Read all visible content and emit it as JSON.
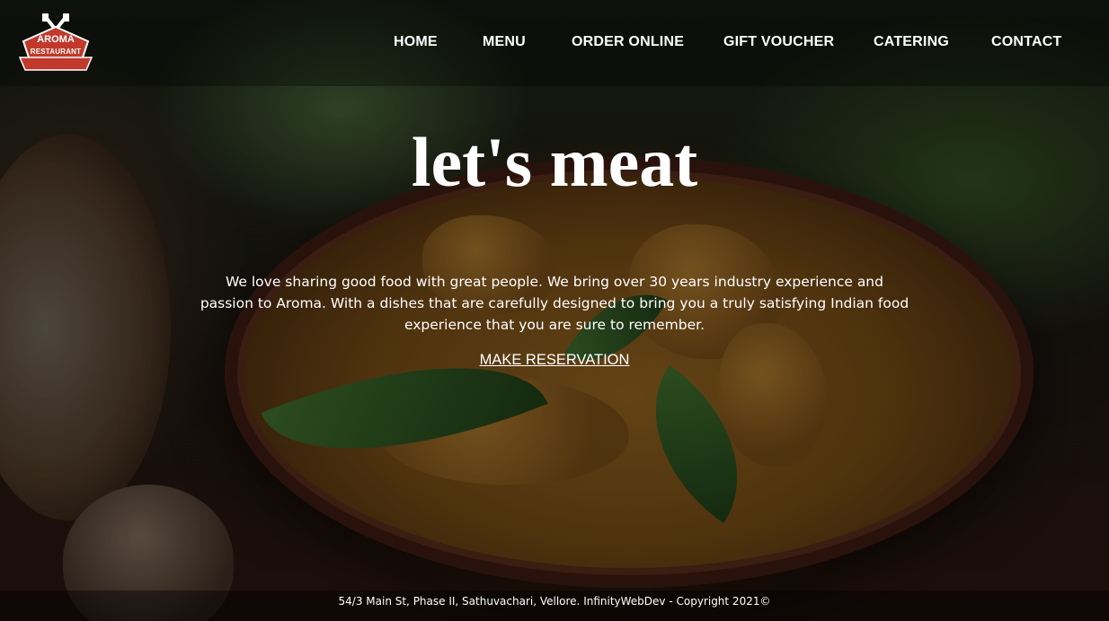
{
  "brand": {
    "name_line1": "AROMA",
    "name_line2": "RESTAURANT",
    "accent_color": "#c0392b"
  },
  "nav": {
    "items": [
      {
        "label": "HOME"
      },
      {
        "label": "MENU"
      },
      {
        "label": "ORDER ONLINE"
      },
      {
        "label": "GIFT VOUCHER"
      },
      {
        "label": "CATERING"
      },
      {
        "label": "CONTACT"
      }
    ]
  },
  "hero": {
    "title": "let's meat",
    "description": "We love sharing good food with great people. We bring over 30 years industry experience and passion to Aroma. With a dishes that are carefully designed to bring you a truly satisfying Indian food experience that you are sure to remember.",
    "cta_label": "MAKE RESERVATION"
  },
  "footer": {
    "text": "54/3 Main St, Phase II, Sathuvachari, Vellore. InfinityWebDev - Copyright 2021©"
  }
}
